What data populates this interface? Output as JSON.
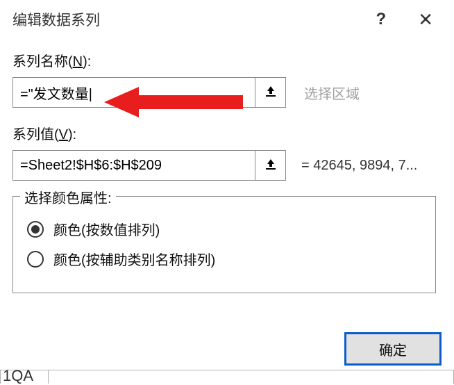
{
  "dialog": {
    "title": "编辑数据系列",
    "help_symbol": "?",
    "close_symbol": "✕"
  },
  "series_name": {
    "label_pre": "系列名称(",
    "label_accel": "N",
    "label_post": "):",
    "value": "=\"发文数量|",
    "hint": "选择区域"
  },
  "series_values": {
    "label_pre": "系列值(",
    "label_accel": "V",
    "label_post": "):",
    "value": "=Sheet2!$H$6:$H$209",
    "preview": "= 42645, 9894, 7..."
  },
  "color_group": {
    "legend": "选择颜色属性:",
    "option_by_value": "颜色(按数值排列)",
    "option_by_category": "颜色(按辅助类别名称排列)",
    "selected": "by_value"
  },
  "buttons": {
    "ok": "确定"
  },
  "footer": {
    "partial_text": "1QA"
  }
}
